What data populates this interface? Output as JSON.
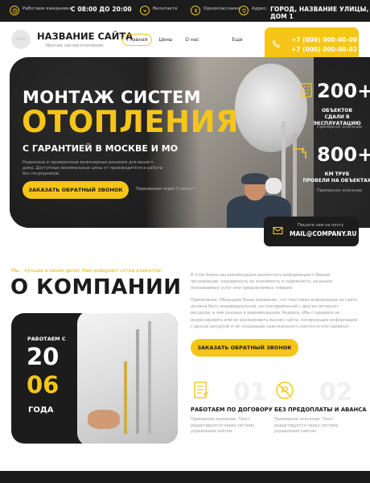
{
  "topbar": {
    "hours_label": "Работаем ежедневно",
    "hours_value": "С 08:00 ДО 20:00",
    "social_vk": "Вконтакте",
    "social_ok": "Одноклассники",
    "address_label": "Адрес:",
    "address_value": "ГОРОД, НАЗВАНИЕ УЛИЦЫ, ДОМ 1"
  },
  "header": {
    "logo": "LOGO",
    "title": "НАЗВАНИЕ САЙТА",
    "subtitle": "Монтаж систем отопления",
    "nav": [
      "Главная",
      "Цены",
      "О нас",
      "Еще"
    ],
    "phone1": "+7 (000) 000-00-00",
    "phone2": "+7 (000) 000-00-02"
  },
  "hero": {
    "line1": "МОНТАЖ СИСТЕМ",
    "line2": "ОТОПЛЕНИЯ",
    "line3": "С ГАРАНТИЕЙ В МОСКВЕ И МО",
    "description": "Надежные и проверенные инженерные решения для вашего дома. Доступные минимальные цены от производителя и работы без посредников.",
    "cta": "ЗАКАЗАТЬ ОБРАТНЫЙ ЗВОНОК",
    "cta_note": "Перезвоним через 5 минут!",
    "stats": [
      {
        "num": "200+",
        "cap1": "ОБЪЕКТОВ",
        "cap2": "СДАЛИ В ЭКСПЛУАТАЦИЮ",
        "note": "Примерное описание"
      },
      {
        "num": "800+",
        "cap1": "КМ ТРУБ",
        "cap2": "ПРОВЕЛИ НА ОБЪЕКТАХ",
        "note": "Примерное описание"
      }
    ],
    "email_label": "Пишите нам на почту",
    "email": "MAIL@COMPANY.RU"
  },
  "about": {
    "kicker": "Мы - лучшие в своем деле! Нам доверяют сотни клиентов!",
    "title": "О КОМПАНИИ",
    "p1": "В этом блоке мы рекомендуем разместить информацию о Вашей организации, подчеркнуть ее значимость и надежность на рынке оказываемых услуг или предлагаемых товаров.",
    "p2": "Примечание. Обращаем Ваше внимание, что текстовая информация на сайте должна быть индивидуальной, не скопированной с других интернет-ресурсов, в чем указано в рекомендациях Яндекса «Мы стараемся не индексировать или не ранжировать высоко сайты, копирующие информацию с других ресурсов и не создающие оригинального контента или сервиса».",
    "cta": "ЗАКАЗАТЬ ОБРАТНЫЙ ЗВОНОК",
    "since_label": "РАБОТАЕМ С",
    "since_top": "20",
    "since_bottom": "06",
    "since_word": "ГОДА",
    "features": [
      {
        "num": "01",
        "title": "РАБОТАЕМ ПО ДОГОВОРУ",
        "text": "Примерное описание. Текст редактируется через систему управления сайтом"
      },
      {
        "num": "02",
        "title": "БЕЗ ПРЕДОПЛАТЫ И АВАНСА",
        "text": "Примерное описание. Текст редактируется через систему управления сайтом"
      }
    ]
  },
  "colors": {
    "accent": "#f5c518",
    "dark": "#1c1c1c"
  }
}
